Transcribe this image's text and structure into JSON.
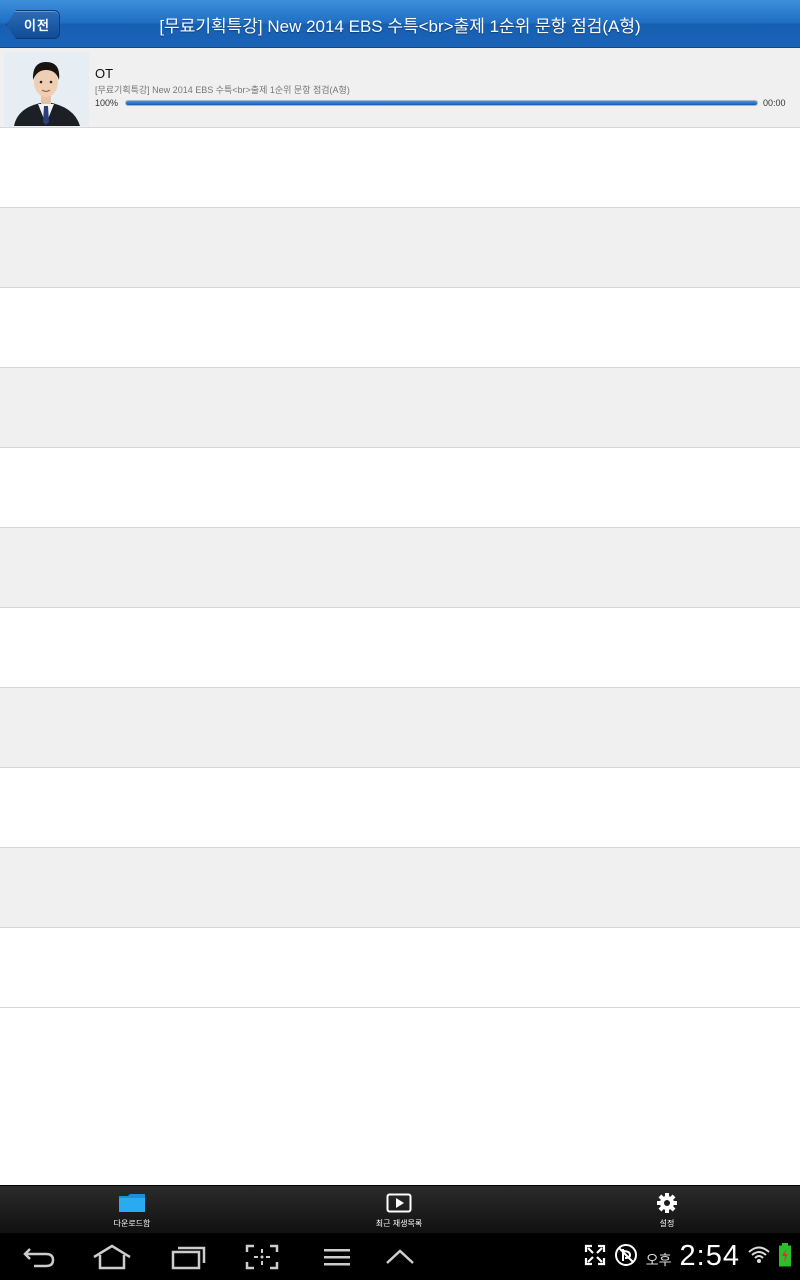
{
  "header": {
    "back_label": "이전",
    "title": "[무료기획특강] New 2014 EBS 수특<br>출제 1순위 문항 점검(A형)"
  },
  "lectures": [
    {
      "title": "OT",
      "subtitle": "[무료기획특강] New 2014 EBS 수특<br>출제 1순위 문항 점검(A형)",
      "progress_label": "100%",
      "progress": 1.0,
      "time": "00:00"
    }
  ],
  "tabbar": {
    "download": "다운로드함",
    "recent": "최근 재생목록",
    "settings": "설정"
  },
  "status": {
    "ampm": "오후",
    "time": "2:54"
  },
  "colors": {
    "header": "#1f6fc4",
    "progress": "#1a5aa8",
    "row_alt": "#f0f0f0",
    "folder_icon": "#1ea0e6"
  }
}
